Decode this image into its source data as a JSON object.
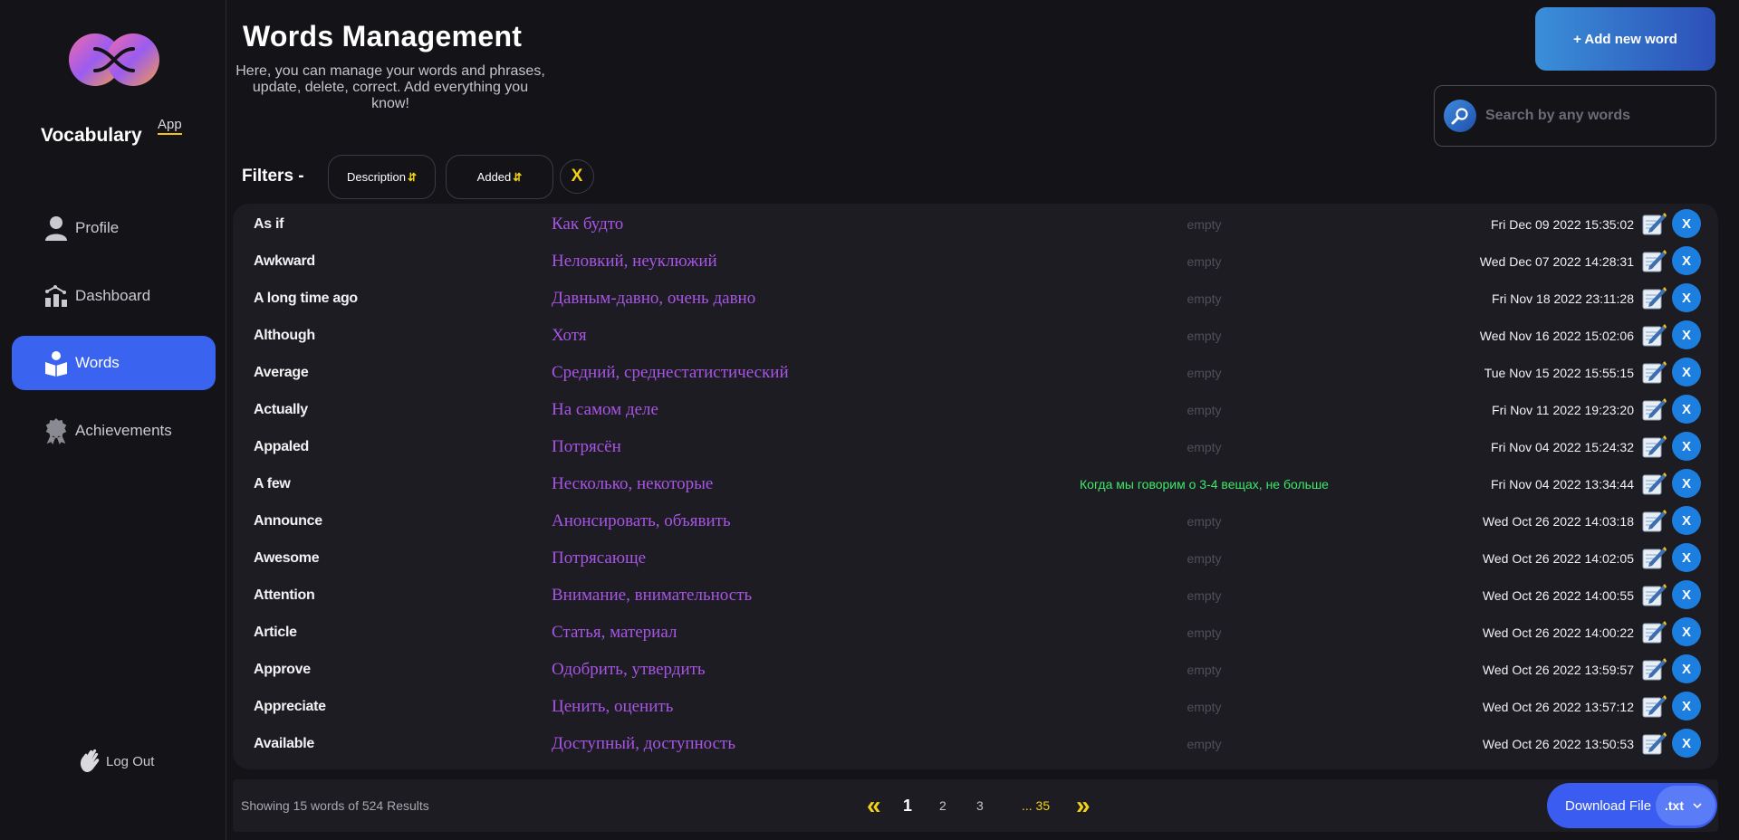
{
  "brand": {
    "name": "Vocabulary",
    "sub": "App"
  },
  "nav": [
    {
      "label": "Profile",
      "icon": "user-icon",
      "active": false
    },
    {
      "label": "Dashboard",
      "icon": "chart-icon",
      "active": false
    },
    {
      "label": "Words",
      "icon": "reading-icon",
      "active": true
    },
    {
      "label": "Achievements",
      "icon": "award-icon",
      "active": false
    }
  ],
  "logout": {
    "label": "Log Out",
    "icon": "wave-hand-icon"
  },
  "header": {
    "title": "Words Management",
    "description": "Here, you can manage your words and phrases, update, delete, correct. Add everything you know!",
    "add_button": "+ Add new word",
    "search_placeholder": "Search by any words"
  },
  "filters": {
    "label": "Filters -",
    "pills": [
      "Description",
      "Added"
    ],
    "sort_glyph": "⇵",
    "clear": "X"
  },
  "rows": [
    {
      "word": "As if",
      "translation": "Как будто",
      "description": "empty",
      "date": "Fri Dec 09 2022 15:35:02"
    },
    {
      "word": "Awkward",
      "translation": "Неловкий, неуклюжий",
      "description": "empty",
      "date": "Wed Dec 07 2022 14:28:31"
    },
    {
      "word": "A long time ago",
      "translation": "Давным-давно, очень давно",
      "description": "empty",
      "date": "Fri Nov 18 2022 23:11:28"
    },
    {
      "word": "Although",
      "translation": "Хотя",
      "description": "empty",
      "date": "Wed Nov 16 2022 15:02:06"
    },
    {
      "word": "Average",
      "translation": "Средний, среднестатистический",
      "description": "empty",
      "date": "Tue Nov 15 2022 15:55:15"
    },
    {
      "word": "Actually",
      "translation": "На самом деле",
      "description": "empty",
      "date": "Fri Nov 11 2022 19:23:20"
    },
    {
      "word": "Appaled",
      "translation": "Потрясён",
      "description": "empty",
      "date": "Fri Nov 04 2022 15:24:32"
    },
    {
      "word": "A few",
      "translation": "Несколько, некоторые",
      "description": "Когда мы говорим о 3-4 вещах, не больше",
      "date": "Fri Nov 04 2022 13:34:44"
    },
    {
      "word": "Announce",
      "translation": "Анонсировать, объявить",
      "description": "empty",
      "date": "Wed Oct 26 2022 14:03:18"
    },
    {
      "word": "Awesome",
      "translation": "Потрясающе",
      "description": "empty",
      "date": "Wed Oct 26 2022 14:02:05"
    },
    {
      "word": "Attention",
      "translation": "Внимание, внимательность",
      "description": "empty",
      "date": "Wed Oct 26 2022 14:00:55"
    },
    {
      "word": "Article",
      "translation": "Статья, материал",
      "description": "empty",
      "date": "Wed Oct 26 2022 14:00:22"
    },
    {
      "word": "Approve",
      "translation": "Одобрить, утвердить",
      "description": "empty",
      "date": "Wed Oct 26 2022 13:59:57"
    },
    {
      "word": "Appreciate",
      "translation": "Ценить, оценить",
      "description": "empty",
      "date": "Wed Oct 26 2022 13:57:12"
    },
    {
      "word": "Available",
      "translation": "Доступный, доступность",
      "description": "empty",
      "date": "Wed Oct 26 2022 13:50:53"
    }
  ],
  "row_actions": {
    "edit_icon": "edit-icon",
    "delete_label": "X"
  },
  "footer": {
    "showing": "Showing 15 words of 524 Results",
    "pagination": {
      "prev": "«",
      "pages": [
        "1",
        "2",
        "3"
      ],
      "current": "1",
      "more": "... 35",
      "next": "»"
    },
    "download_label": "Download File",
    "format": ".txt"
  },
  "colors": {
    "accent": "#3a63f0",
    "translation": "#a855e6",
    "description_filled": "#3ee86a",
    "highlight": "#f2d218",
    "delete": "#1c7fe0"
  }
}
